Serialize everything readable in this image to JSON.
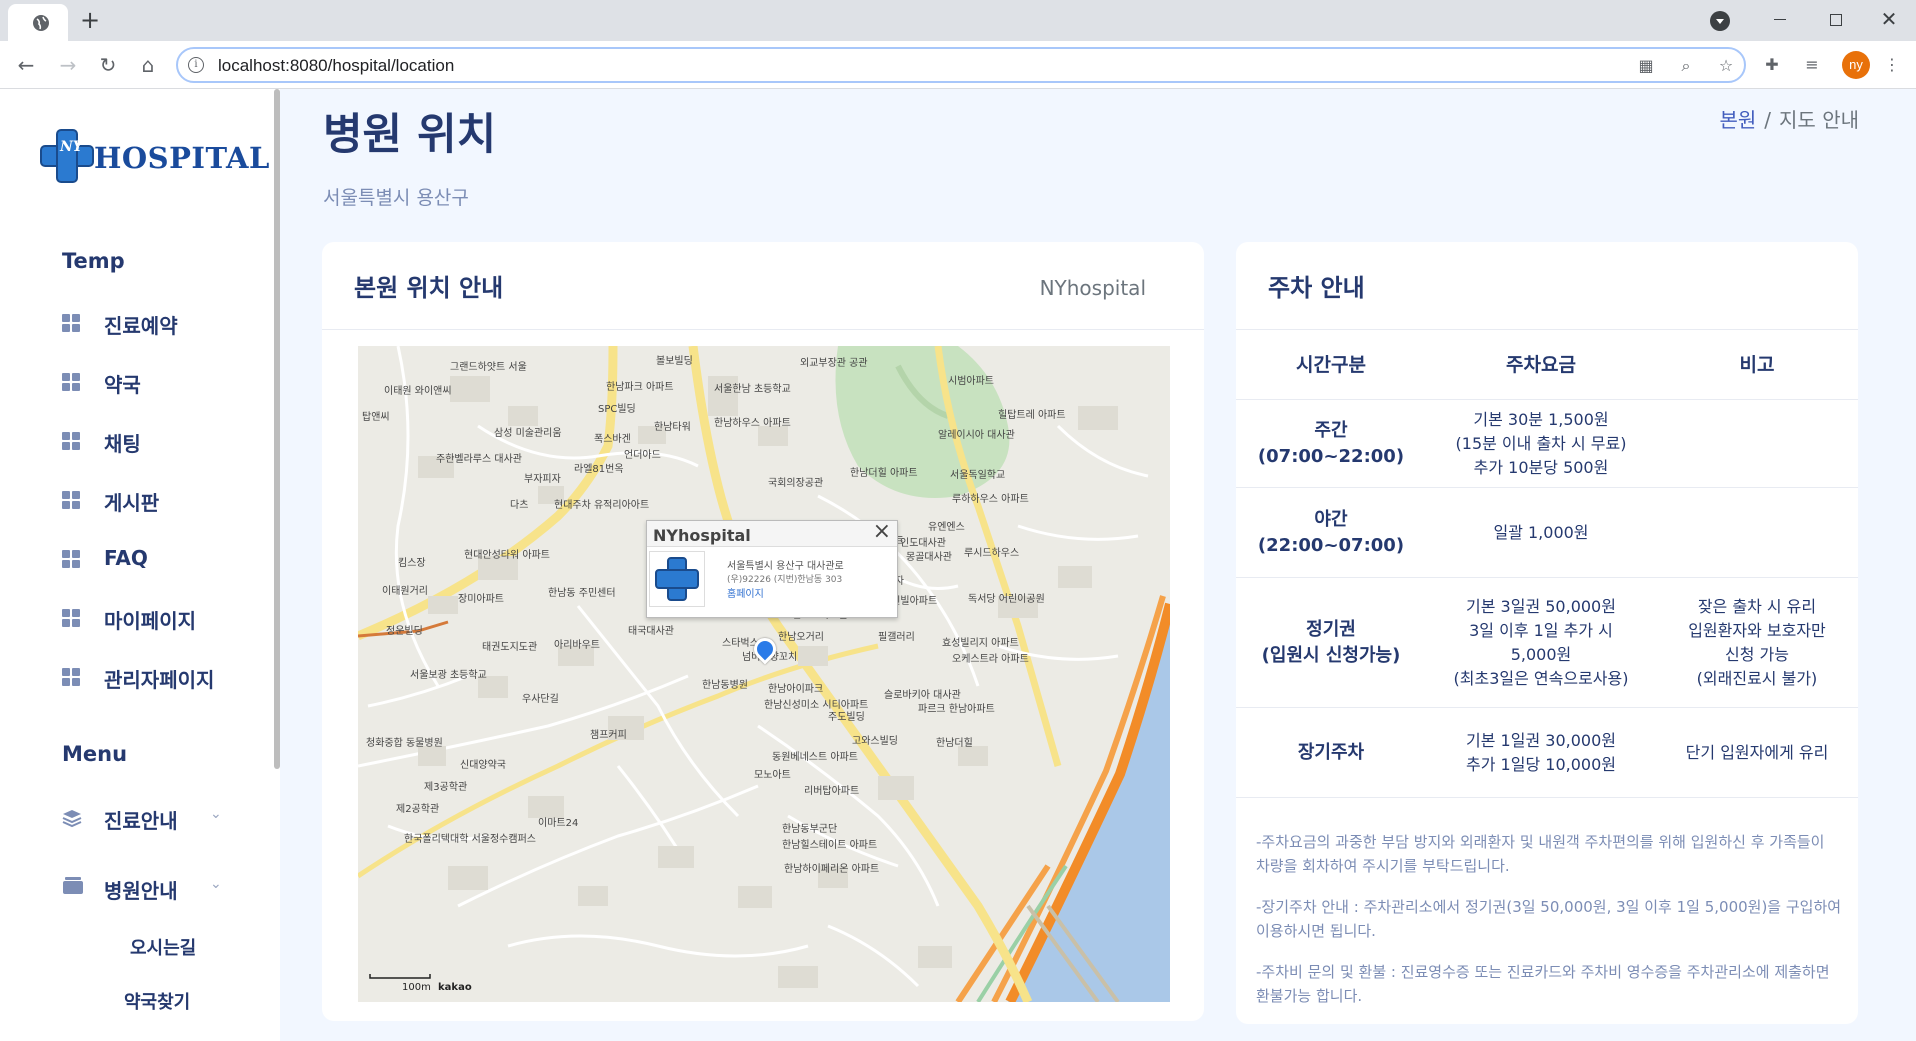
{
  "browser": {
    "url": "localhost:8080/hospital/location",
    "profile_initials": "ny"
  },
  "sidebar": {
    "brand": "HOSPITAL",
    "brand_mark": "NY",
    "section_temp": "Temp",
    "items": [
      {
        "label": "진료예약"
      },
      {
        "label": "약국"
      },
      {
        "label": "채팅"
      },
      {
        "label": "게시판"
      },
      {
        "label": "FAQ"
      },
      {
        "label": "마이페이지"
      },
      {
        "label": "관리자페이지"
      }
    ],
    "section_menu": "Menu",
    "menu_items": [
      {
        "label": "진료안내"
      },
      {
        "label": "병원안내"
      }
    ],
    "sub_items": [
      {
        "label": "오시는길"
      },
      {
        "label": "약국찾기"
      }
    ]
  },
  "page": {
    "title": "병원 위치",
    "subtitle": "서울특별시 용산구",
    "breadcrumb": {
      "home": "본원",
      "current": "지도 안내"
    }
  },
  "map_card": {
    "title": "본원 위치 안내",
    "right_label": "NYhospital",
    "info_window": {
      "title": "NYhospital",
      "address": "서울특별시 용산구 대사관로",
      "address_detail": "(우)92226 (지번)한남동 303",
      "link": "홈페이지"
    },
    "scale_text": "100m",
    "provider": "kakao"
  },
  "parking_card": {
    "title": "주차 안내",
    "headers": [
      "시간구분",
      "주차요금",
      "비고"
    ],
    "rows": [
      {
        "period": "주간",
        "period_sub": "(07:00~22:00)",
        "fee_lines": [
          "기본 30분 1,500원",
          "(15분 이내 출차 시 무료)",
          "추가 10분당 500원"
        ],
        "note_lines": []
      },
      {
        "period": "야간",
        "period_sub": "(22:00~07:00)",
        "fee_lines": [
          "일괄 1,000원"
        ],
        "note_lines": []
      },
      {
        "period": "정기권",
        "period_sub": "(입원시 신청가능)",
        "fee_lines": [
          "기본 3일권 50,000원",
          "3일 이후 1일 추가 시",
          "5,000원",
          "(최초3일은 연속으로사용)"
        ],
        "note_lines": [
          "잦은 출차 시 유리",
          "입원환자와 보호자만",
          "신청 가능",
          "(외래진료시 불가)"
        ]
      },
      {
        "period": "장기주차",
        "period_sub": "",
        "fee_lines": [
          "기본 1일권 30,000원",
          "추가 1일당 10,000원"
        ],
        "note_lines": [
          "단기 입원자에게 유리"
        ]
      }
    ],
    "notes": [
      "-주차요금의 과중한 부담 방지와 외래환자 및 내원객 주차편의를 위해 입원하신 후 가족들이 차량을 회차하여 주시기를 부탁드립니다.",
      "-장기주차 안내 : 주차관리소에서 정기권(3일 50,000원, 3일 이후 1일 5,000원)을 구입하여 이용하시면 됩니다.",
      "-주차비 문의 및 환불 : 진료영수증 또는 진료카드와 주차비 영수증을 주차관리소에 제출하면 환불가능 합니다."
    ]
  },
  "map_labels": [
    "그랜드하얏트 서울",
    "이태원 와이앤씨",
    "탑앤씨",
    "삼성 미술관리움",
    "주한벨라루스 대사관",
    "부자피자",
    "다츠",
    "현대주차 유적리아아트",
    "킴스장",
    "현대안성타워 아파트",
    "이태원거리",
    "장미아파트",
    "정운빌딩",
    "태권도지도관",
    "서울보광 초등학교",
    "우사단길",
    "챔프커피",
    "신대양약국",
    "제3공학관",
    "제2공학관",
    "한국폴리텍대학 서울정수캠퍼스",
    "이마트24",
    "한남동 주민센터",
    "아리바우트",
    "태국대사관",
    "스타벅스",
    "한남동병원",
    "한남신성미소 시티아파트",
    "주도빌딩",
    "고와스빌딩",
    "동원베네스트 아파트",
    "모노아트",
    "리버탑아파트",
    "한남동부군단",
    "한남힐스테이트 아파트",
    "한남하이페리온 아파트",
    "SPC빌딩",
    "한남타워",
    "한남하우스 아파트",
    "외교부장관 공관",
    "서울한남 초등학교",
    "국회의장공관",
    "한남더힐 아파트",
    "알레이시아 대사관",
    "서울독일학교",
    "루하하우스 아파트",
    "유엔엔스",
    "인도대사관",
    "몽골대사관",
    "루시드하우스",
    "글러브 엔터테인먼트",
    "미스틱스토리",
    "신원프라자",
    "트윈빌아파트",
    "독서당 어린이공원",
    "효성빌리지 아파트",
    "오케스트라 아파트",
    "필갤러리",
    "슬로바키아 대사관",
    "파르크 한남아파트",
    "한남더힐",
    "시범아파트",
    "힐탑트레 아파트",
    "한남파크 아파트",
    "볼보빌딩",
    "연고오피스텔",
    "넘버원향꼬치",
    "한남아이파크",
    "SK주유소",
    "GS25",
    "한남오거리",
    "순천향대학부속 서울병원",
    "라엘81번옥",
    "언더아드",
    "폭스바겐",
    "청화중합 동물병원"
  ]
}
